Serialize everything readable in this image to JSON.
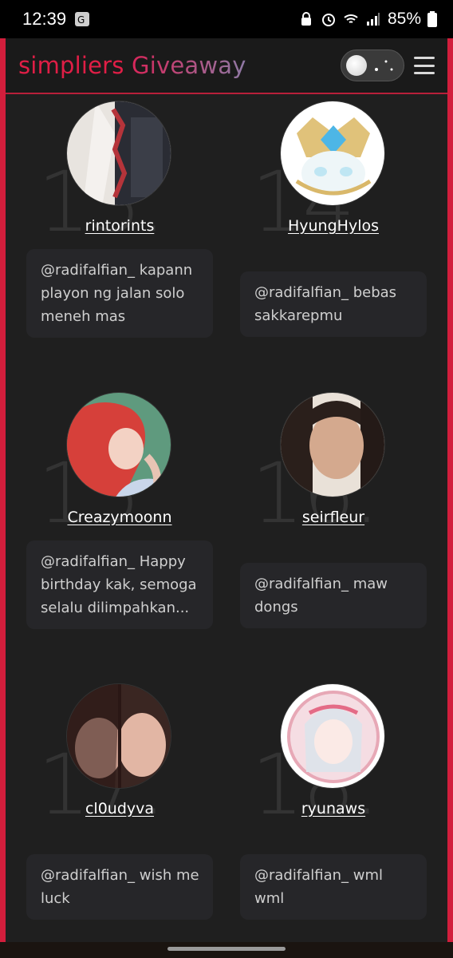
{
  "status": {
    "time": "12:39",
    "battery": "85%"
  },
  "header": {
    "brand_part1": "simpliers",
    "brand_part2": "Giveaway"
  },
  "entries": [
    {
      "number": "13.",
      "username": "rintorints",
      "comment": "@radifalfian_ kapann playon ng jalan solo meneh mas"
    },
    {
      "number": "14.",
      "username": "HyungHylos",
      "comment": "@radifalfian_ bebas sakkarepmu"
    },
    {
      "number": "15.",
      "username": "Creazymoonn",
      "comment": "@radifalfian_ Happy birthday kak, semoga selalu dilimpahkan..."
    },
    {
      "number": "16.",
      "username": "seirfleur",
      "comment": "@radifalfian_ maw dongs"
    },
    {
      "number": "17.",
      "username": "cl0udyva",
      "comment": "@radifalfian_ wish me luck"
    },
    {
      "number": "18.",
      "username": "ryunaws",
      "comment": "@radifalfian_ wml wml"
    }
  ]
}
